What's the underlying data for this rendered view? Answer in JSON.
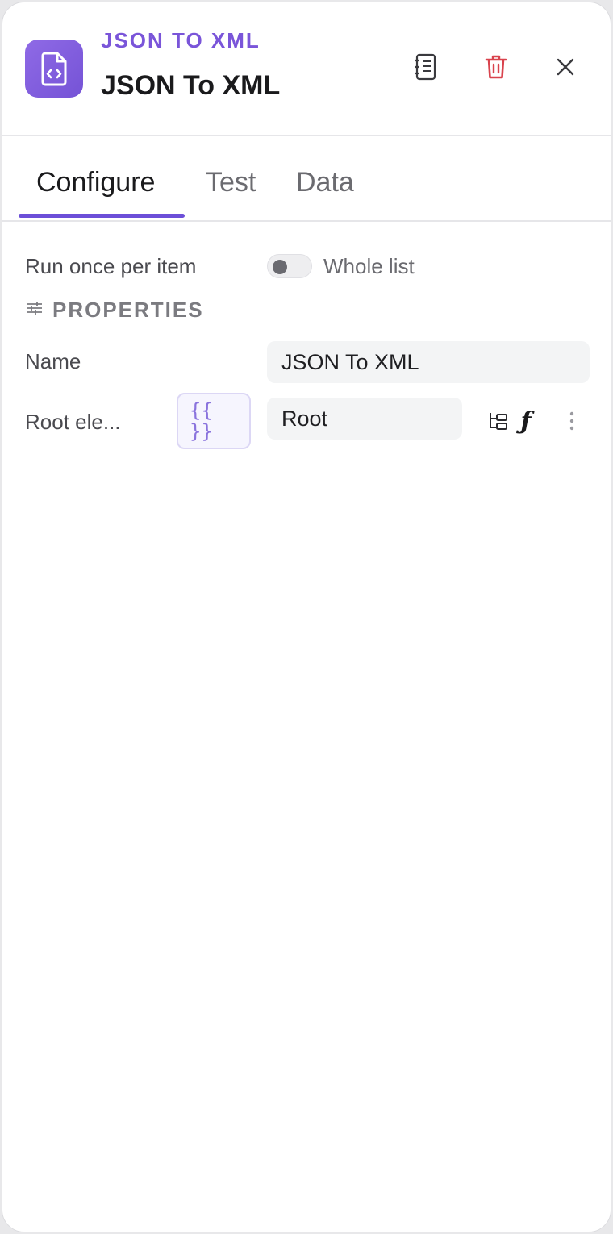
{
  "header": {
    "kicker": "JSON TO XML",
    "title": "JSON To XML",
    "icons": {
      "app": "file-code-icon",
      "notes": "notebook-icon",
      "delete": "trash-icon",
      "close": "close-icon"
    },
    "accent_color": "#7a55d9",
    "delete_color": "#d9434d"
  },
  "tabs": [
    {
      "label": "Configure",
      "active": true
    },
    {
      "label": "Test",
      "active": false
    },
    {
      "label": "Data",
      "active": false
    }
  ],
  "run_mode": {
    "left_label": "Run once per item",
    "right_label": "Whole list",
    "whole_list_enabled": false
  },
  "properties": {
    "section_title": "PROPERTIES",
    "name": {
      "label": "Name",
      "value": "JSON To XML"
    },
    "root_element": {
      "label": "Root ele...",
      "expression_toggle_top": "{{",
      "expression_toggle_bottom": "}}",
      "value": "Root",
      "icons": [
        "tree-icon",
        "function-icon",
        "more-vertical-icon"
      ]
    }
  }
}
